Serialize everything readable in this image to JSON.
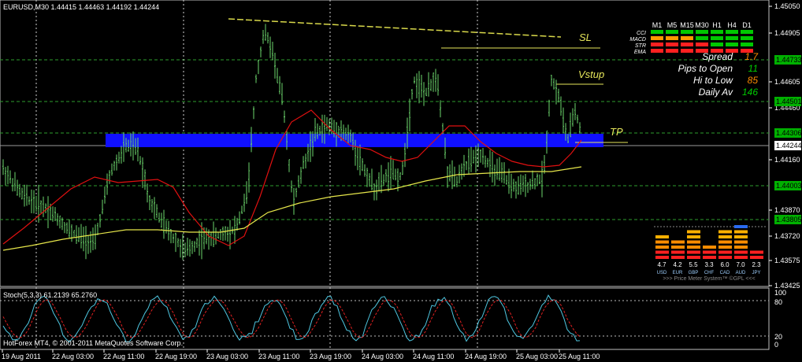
{
  "header": {
    "symbol_line": "EURUSD,M30  1.44415 1.44463 1.44192 1.44244"
  },
  "stoch_label": "Stoch(5,3,3) 61.2139 65.2760",
  "copyright": "HotForex MT4, © 2001-2011 MetaQuotes Software Corp.",
  "price_axis": {
    "labels": [
      "1.45050",
      "1.44905",
      "1.44605",
      "1.44460",
      "1.44160",
      "1.43870",
      "1.43720",
      "1.43575",
      "1.43425"
    ],
    "markers": [
      {
        "label": "1.44733",
        "color": "#00b000"
      },
      {
        "label": "1.44501",
        "color": "#00b000"
      },
      {
        "label": "1.44306",
        "color": "#00b000"
      },
      {
        "label": "1.44244",
        "color": "#ffffff"
      },
      {
        "label": "1.44003",
        "color": "#00b000"
      },
      {
        "label": "1.43805",
        "color": "#00b000"
      }
    ]
  },
  "stoch_axis": [
    "100",
    "80",
    "20",
    "0"
  ],
  "time_axis": [
    "19 Aug 2011",
    "22 Aug 03:00",
    "22 Aug 11:00",
    "22 Aug 19:00",
    "23 Aug 03:00",
    "23 Aug 11:00",
    "23 Aug 19:00",
    "24 Aug 03:00",
    "24 Aug 11:00",
    "24 Aug 19:00",
    "25 Aug 03:00",
    "25 Aug 11:00"
  ],
  "annotations": {
    "sl": "SL",
    "vstup": "Vstup",
    "tp": "TP"
  },
  "trend_panel": {
    "columns": [
      "M1",
      "M5",
      "M15",
      "M30",
      "H1",
      "H4",
      "D1"
    ],
    "rows": [
      {
        "label": "CCI",
        "colors": [
          "green",
          "green",
          "green",
          "green",
          "green",
          "green",
          "green"
        ]
      },
      {
        "label": "MACD",
        "colors": [
          "orange",
          "orange",
          "orange",
          "green",
          "green",
          "green",
          "green"
        ]
      },
      {
        "label": "STR",
        "colors": [
          "red",
          "red",
          "red",
          "red",
          "green",
          "green",
          "green"
        ]
      },
      {
        "label": "EMA",
        "colors": [
          "red",
          "red",
          "red",
          "red",
          "red",
          "red",
          "red"
        ]
      }
    ]
  },
  "stats": [
    {
      "label": "Spread",
      "value": "1.7",
      "color": "#ff8c00"
    },
    {
      "label": "Pips to Open",
      "value": "11",
      "color": "#00cc00"
    },
    {
      "label": "Hi to Low",
      "value": "85",
      "color": "#ff8c00"
    },
    {
      "label": "Daily Av",
      "value": "146",
      "color": "#00cc00"
    }
  ],
  "price_meter": {
    "currencies": [
      {
        "name": "USD",
        "value": "4.7"
      },
      {
        "name": "EUR",
        "value": "4.2"
      },
      {
        "name": "GBP",
        "value": "5.5"
      },
      {
        "name": "CHF",
        "value": "3.3"
      },
      {
        "name": "CAD",
        "value": "6.0"
      },
      {
        "name": "AUD",
        "value": "7.0"
      },
      {
        "name": "JPY",
        "value": "2.3"
      }
    ],
    "footer": ">>> Price Meter System™ ©GPL <<<"
  }
}
